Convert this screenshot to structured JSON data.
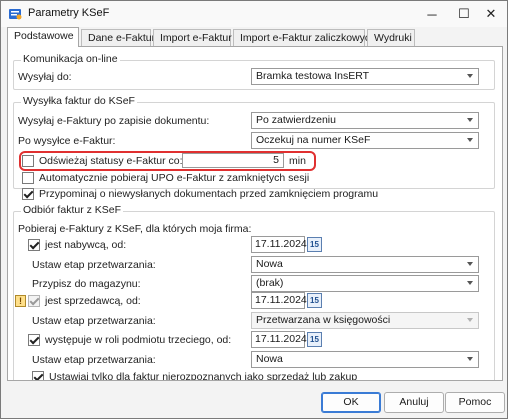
{
  "window": {
    "title": "Parametry KSeF",
    "minimize": "─",
    "maximize": "☐",
    "close": "✕"
  },
  "tabs": [
    {
      "label": "Podstawowe",
      "active": true
    },
    {
      "label": "Dane e-Faktur",
      "active": false
    },
    {
      "label": "Import e-Faktur",
      "active": false
    },
    {
      "label": "Import e-Faktur zaliczkowych",
      "active": false
    },
    {
      "label": "Wydruki",
      "active": false
    }
  ],
  "online": {
    "title": "Komunikacja on-line",
    "send_to_label": "Wysyłaj do:",
    "send_to_value": "Bramka testowa InsERT"
  },
  "sending": {
    "title": "Wysyłka faktur do KSeF",
    "after_save_label": "Wysyłaj e-Faktury po zapisie dokumentu:",
    "after_save_value": "Po zatwierdzeniu",
    "after_send_label": "Po wysyłce e-Faktur:",
    "after_send_value": "Oczekuj na numer KSeF",
    "refresh_label": "Odświeżaj statusy e-Faktur co:",
    "refresh_checked": false,
    "refresh_value": "5",
    "refresh_unit": "min",
    "auto_upo_label": "Automatycznie pobieraj UPO e-Faktur z zamkniętych sesji",
    "auto_upo_checked": false,
    "remind_label": "Przypominaj o niewysłanych dokumentach przed zamknięciem programu",
    "remind_checked": true
  },
  "receiving": {
    "title": "Odbiór faktur z KSeF",
    "intro": "Pobieraj e-Faktury z KSeF, dla których moja firma:",
    "buyer_label": "jest nabywcą, od:",
    "buyer_checked": true,
    "buyer_date": "17.11.2024",
    "buyer_stage_label": "Ustaw etap przetwarzania:",
    "buyer_stage_value": "Nowa",
    "warehouse_label": "Przypisz do magazynu:",
    "warehouse_value": "(brak)",
    "seller_label": "jest sprzedawcą, od:",
    "seller_checked": true,
    "seller_warn": "!",
    "seller_date": "17.11.2024",
    "seller_stage_label": "Ustaw etap przetwarzania:",
    "seller_stage_value": "Przetwarzana w księgowości",
    "third_label": "występuje w roli podmiotu trzeciego, od:",
    "third_checked": true,
    "third_date": "17.11.2024",
    "third_stage_label": "Ustaw etap przetwarzania:",
    "third_stage_value": "Nowa",
    "unrecognized_label": "Ustawiaj tylko dla faktur nierozpoznanych jako sprzedaż lub zakup",
    "unrecognized_checked": true,
    "calendar_day": "15"
  },
  "footer": {
    "ok": "OK",
    "cancel": "Anuluj",
    "help": "Pomoc"
  }
}
